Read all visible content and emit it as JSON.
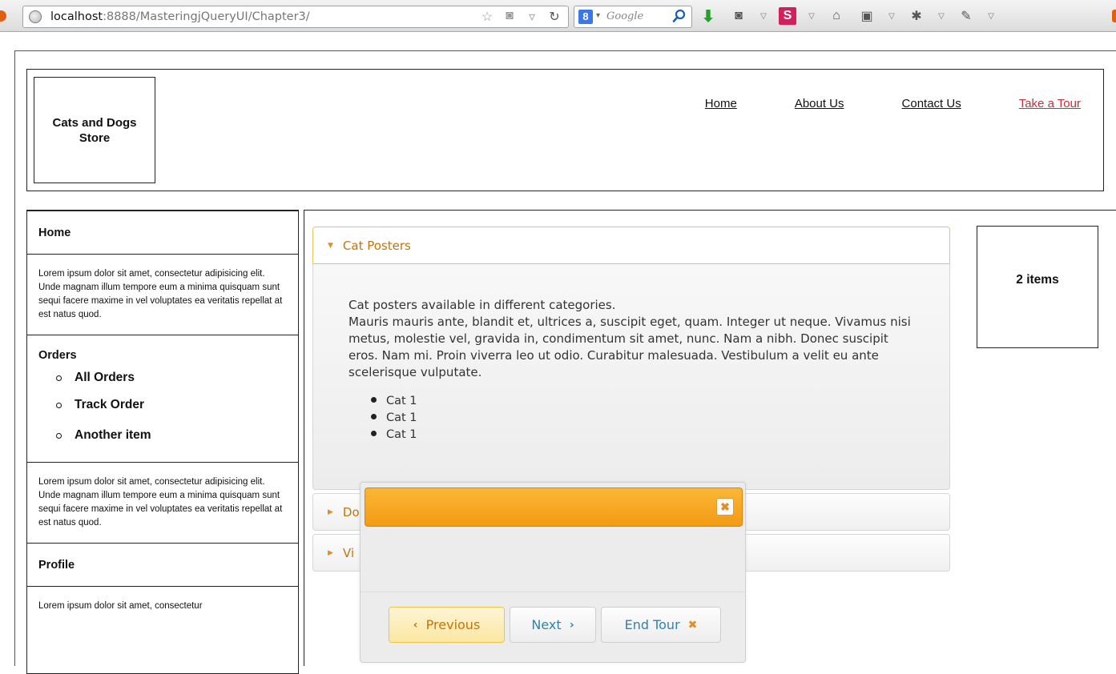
{
  "browser": {
    "url_host": "localhost",
    "url_rest": ":8888/MasteringjQueryUI/Chapter3/",
    "search_engine": "Google"
  },
  "header": {
    "logo_text": "Cats and Dogs Store",
    "nav": [
      "Home",
      "About Us",
      "Contact Us",
      "Take a Tour"
    ]
  },
  "sidebar": {
    "home_title": "Home",
    "home_text": "Lorem ipsum dolor sit amet, consectetur adipisicing elit. Unde magnam illum tempore eum a minima quisquam sunt sequi facere maxime in vel voluptates ea veritatis repellat at est natus quod.",
    "orders_title": "Orders",
    "orders_items": [
      "All Orders",
      "Track Order",
      "Another item"
    ],
    "orders_text": "Lorem ipsum dolor sit amet, consectetur adipisicing elit. Unde magnam illum tempore eum a minima quisquam sunt sequi facere maxime in vel voluptates ea veritatis repellat at est natus quod.",
    "profile_title": "Profile",
    "profile_text": "Lorem ipsum dolor sit amet, consectetur"
  },
  "accordion": {
    "active_header": "Cat Posters",
    "content_lead": "Cat posters available in different categories.",
    "content_body": "Mauris mauris ante, blandit et, ultrices a, suscipit eget, quam. Integer ut neque. Vivamus nisi metus, molestie vel, gravida in, condimentum sit amet, nunc. Nam a nibh. Donec suscipit eros. Nam mi. Proin viverra leo ut odio. Curabitur malesuada. Vestibulum a velit eu ante scelerisque vulputate.",
    "list_items": [
      "Cat 1",
      "Cat 1",
      "Cat 1"
    ],
    "collapsed_headers": [
      "Do",
      "Vi"
    ]
  },
  "cart": {
    "label": "2 items"
  },
  "tour": {
    "close_glyph": "✖",
    "prev_label": "Previous",
    "next_label": "Next",
    "end_label": "End Tour"
  },
  "colors": {
    "accent_orange": "#f39a13",
    "header_text": "#c77405",
    "button_text": "#2b84b4",
    "tour_link": "#c73038"
  }
}
